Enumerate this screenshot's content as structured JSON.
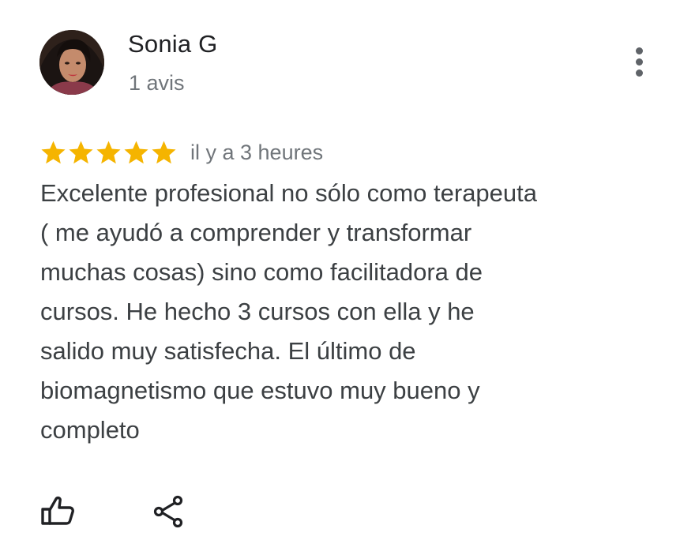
{
  "review": {
    "reviewer_name": "Sonia G",
    "review_count": "1 avis",
    "rating": 5,
    "rating_max": 5,
    "time": "il y a 3 heures",
    "text": "Excelente profesional no sólo como terapeuta\n( me ayudó a comprender y transformar\nmuchas cosas) sino como facilitadora de\ncursos.  He hecho 3 cursos con ella y he\nsalido muy satisfecha.  El último de\nbiomagnetismo que estuvo muy bueno y\ncompleto"
  },
  "icons": {
    "avatar": "avatar-photo",
    "menu": "more-vert-icon",
    "star": "star-icon",
    "like": "thumb-up-icon",
    "share": "share-icon"
  },
  "colors": {
    "star": "#f5b400",
    "name": "#202124",
    "secondary_text": "#70757a",
    "body_text": "#3c4043",
    "icon": "#202124",
    "menu_icon": "#5f6368"
  }
}
